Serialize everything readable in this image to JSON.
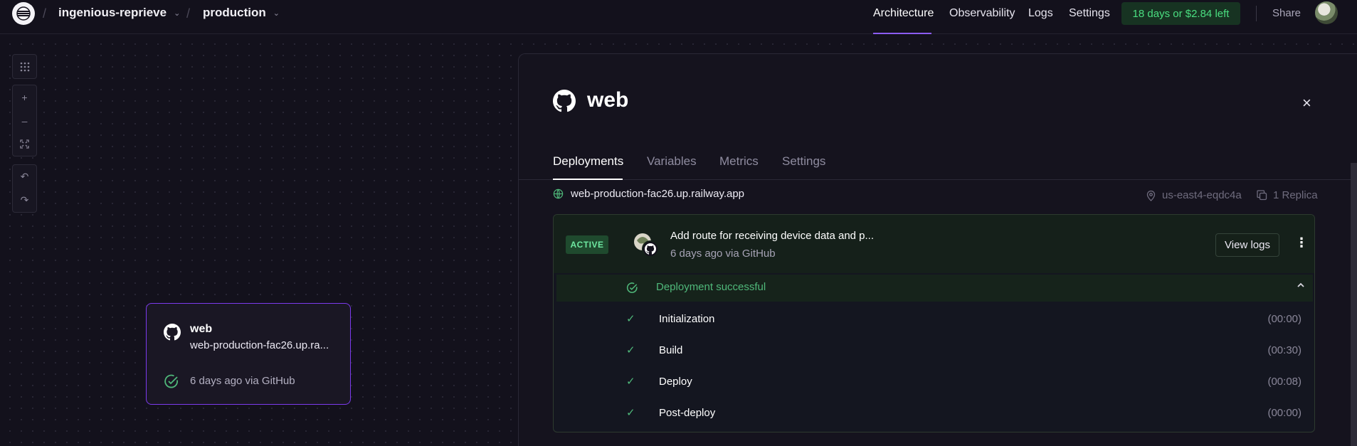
{
  "topbar": {
    "project": "ingenious-reprieve",
    "environment": "production",
    "nav": [
      "Architecture",
      "Observability",
      "Logs",
      "Settings"
    ],
    "active_nav": "Architecture",
    "trial": "18 days or $2.84 left",
    "share": "Share"
  },
  "canvas_tools": {
    "icons": [
      "grid-icon",
      "zoom-in-icon",
      "zoom-out-icon",
      "fit-view-icon",
      "undo-icon",
      "redo-icon"
    ]
  },
  "service_card": {
    "name": "web",
    "url": "web-production-fac26.up.ra...",
    "status": "6 days ago via GitHub"
  },
  "panel": {
    "title": "web",
    "tabs": [
      "Deployments",
      "Variables",
      "Metrics",
      "Settings"
    ],
    "active_tab": "Deployments",
    "domain": "web-production-fac26.up.railway.app",
    "region": "us-east4-eqdc4a",
    "replicas": "1 Replica",
    "deployment": {
      "badge": "ACTIVE",
      "commit_message": "Add route for receiving device data and p...",
      "meta": "6 days ago via GitHub",
      "view_logs": "View logs",
      "status": "Deployment successful",
      "steps": [
        {
          "name": "Initialization",
          "time": "(00:00)"
        },
        {
          "name": "Build",
          "time": "(00:30)"
        },
        {
          "name": "Deploy",
          "time": "(00:08)"
        },
        {
          "name": "Post-deploy",
          "time": "(00:00)"
        }
      ]
    }
  },
  "colors": {
    "accent": "#8b5cf6",
    "success": "#4ade80",
    "background": "#13111c"
  }
}
